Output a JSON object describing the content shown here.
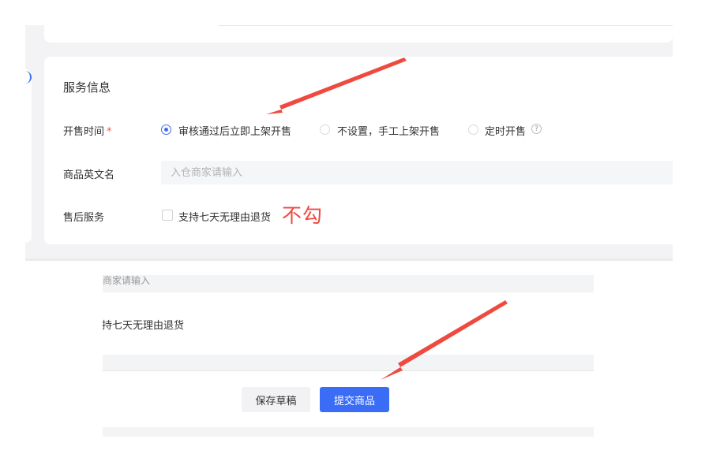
{
  "service_section": {
    "title": "服务信息",
    "sale_time": {
      "label": "开售时间",
      "required_mark": "*",
      "options": [
        {
          "label": "审核通过后立即上架开售",
          "checked": true
        },
        {
          "label": "不设置，手工上架开售",
          "checked": false
        },
        {
          "label": "定时开售",
          "checked": false
        }
      ],
      "help_icon_glyph": "?"
    },
    "english_name": {
      "label": "商品英文名",
      "placeholder": "入仓商家请输入",
      "value": ""
    },
    "after_sales": {
      "label": "售后服务",
      "checkbox_label": "支持七天无理由退货",
      "checked": false
    },
    "annotation": "不勾"
  },
  "lower_crop": {
    "placeholder_fragment": "商家请输入",
    "checkbox_label_fragment": "持七天无理由退货"
  },
  "actions": {
    "save_draft_label": "保存草稿",
    "submit_label": "提交商品"
  },
  "colors": {
    "primary": "#3b6cf6",
    "annotation": "#ee4a3f",
    "background": "#f3f3f5"
  },
  "icons": [
    "radio-icon",
    "help-icon",
    "checkbox-icon",
    "arrow-annotation-icon"
  ]
}
